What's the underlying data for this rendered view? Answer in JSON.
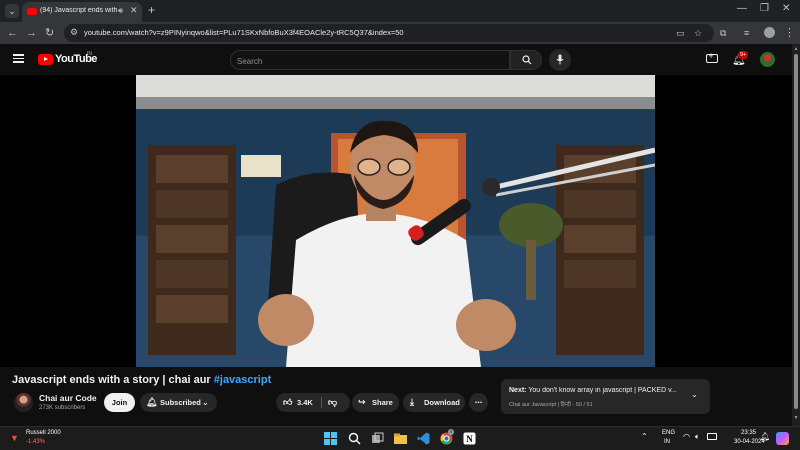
{
  "browser": {
    "tab_title": "(94) Javascript ends with a s",
    "url": "youtube.com/watch?v=z9PINyinqwo&list=PLu71SKxNbfoBuX3f4EOACle2y-tRC5Q37&index=50"
  },
  "youtube": {
    "logo_text": "YouTube",
    "region": "IN",
    "search_placeholder": "Search",
    "notification_count": "9+"
  },
  "video": {
    "title": "Javascript ends with a story | chai aur ",
    "hashtag": "#javascript",
    "channel_name": "Chai aur Code",
    "subscribers": "273K subscribers",
    "join_label": "Join",
    "subscribed_label": "Subscribed",
    "likes": "3.4K",
    "share_label": "Share",
    "download_label": "Download"
  },
  "up_next": {
    "label": "Next:",
    "title": "You don't know array in javascript | PACKED v...",
    "meta": "Chai aur Javascript | हिन्दी · 50 / 51"
  },
  "taskbar": {
    "ticker_name": "Russell 2000",
    "ticker_change": "-1.43%",
    "lang_line1": "ENG",
    "lang_line2": "IN",
    "time": "23:35",
    "date": "30-04-2024",
    "notif_badge": "4"
  },
  "colors": {
    "yt_red": "#ff0000",
    "link_blue": "#3ea6ff",
    "background": "#0f0f0f"
  }
}
